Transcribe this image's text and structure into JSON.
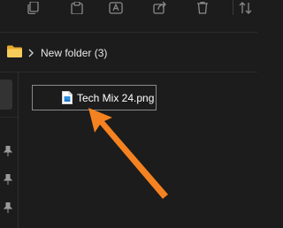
{
  "toolbar": {
    "buttons": [
      {
        "icon": "copy-icon"
      },
      {
        "icon": "paste-icon"
      },
      {
        "icon": "rename-icon"
      },
      {
        "icon": "share-icon"
      },
      {
        "icon": "delete-icon"
      },
      {
        "icon": "sort-icon"
      }
    ]
  },
  "address_bar": {
    "folder_icon": "folder-icon",
    "separator_icon": "chevron-right-icon",
    "current_folder": "New folder (3)"
  },
  "navigation_pane": {
    "pinned_icons": [
      "pin-icon",
      "pin-icon",
      "pin-icon"
    ]
  },
  "files": [
    {
      "name": "Tech Mix 24.png",
      "icon": "image-file-icon",
      "selected": true
    }
  ],
  "annotation": {
    "icon": "orange-arrow",
    "color": "#f58220"
  },
  "colors": {
    "background": "#1c1c1c",
    "accent_arrow": "#f58220",
    "text": "#ffffff"
  }
}
